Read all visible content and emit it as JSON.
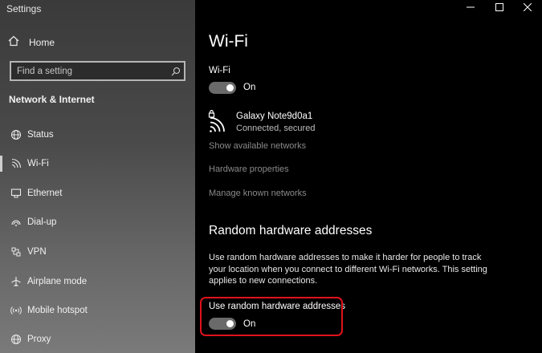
{
  "window": {
    "app_title": "Settings",
    "controls": [
      "minimize",
      "maximize",
      "close"
    ]
  },
  "sidebar": {
    "home_label": "Home",
    "search_placeholder": "Find a setting",
    "section_title": "Network & Internet",
    "items": [
      {
        "label": "Status",
        "icon": "globe-icon"
      },
      {
        "label": "Wi-Fi",
        "icon": "wifi-icon",
        "active": true
      },
      {
        "label": "Ethernet",
        "icon": "ethernet-icon"
      },
      {
        "label": "Dial-up",
        "icon": "dialup-icon"
      },
      {
        "label": "VPN",
        "icon": "vpn-icon"
      },
      {
        "label": "Airplane mode",
        "icon": "airplane-icon"
      },
      {
        "label": "Mobile hotspot",
        "icon": "hotspot-icon"
      },
      {
        "label": "Proxy",
        "icon": "proxy-globe-icon"
      }
    ]
  },
  "main": {
    "title": "Wi-Fi",
    "wifi_toggle_label": "Wi-Fi",
    "wifi_toggle_state": "On",
    "network": {
      "name": "Galaxy Note9d0a1",
      "status": "Connected, secured"
    },
    "links": {
      "show_networks": "Show available networks",
      "hardware_properties": "Hardware properties",
      "manage_networks": "Manage known networks"
    },
    "random_section": {
      "title": "Random hardware addresses",
      "description": "Use random hardware addresses to make it harder for people to track your location when you connect to different Wi-Fi networks. This setting applies to new connections.",
      "toggle_label": "Use random hardware addresses",
      "toggle_state": "On"
    }
  },
  "colors": {
    "highlight": "#e0121b",
    "toggle_track": "#6a6a6a",
    "link": "#8a8a8a"
  }
}
